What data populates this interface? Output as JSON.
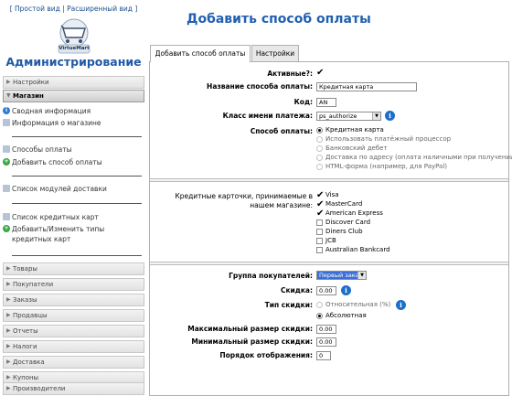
{
  "sidebar": {
    "view_simple": "Простой вид",
    "view_extended": "Расширенный вид",
    "logo_text": "VirtueMart",
    "title": "Администрирование",
    "sections": {
      "settings": "Настройки",
      "shop": "Магазин",
      "products": "Товары",
      "customers": "Покупатели",
      "orders": "Заказы",
      "vendors": "Продавцы",
      "reports": "Отчеты",
      "taxes": "Налоги",
      "shipping": "Доставка",
      "coupons": "Купоны",
      "manufacturers": "Производители"
    },
    "shop_items": {
      "summary": "Сводная информация",
      "shop_info": "Информация о магазине",
      "payment_methods": "Способы оплаты",
      "add_payment": "Добавить способ оплаты",
      "shipping_modules": "Список модулей доставки",
      "credit_cards": "Список кредитных карт",
      "add_card_types": "Добавить/Изменить типы кредитных карт"
    }
  },
  "main": {
    "title": "Добавить способ оплаты",
    "tabs": [
      "Добавить способ оплаты",
      "Настройки"
    ],
    "form": {
      "active_label": "Активные?:",
      "name_label": "Название способа оплаты:",
      "name_value": "Кредитная карта",
      "code_label": "Код:",
      "code_value": "AN",
      "class_label": "Класс имени платежа:",
      "class_value": "ps_authorize",
      "method_label": "Способ оплаты:",
      "method_options": [
        "Кредитная карта",
        "Использовать платёжный процессор",
        "Банковский дебет",
        "Доставка по адресу (оплата наличными при получении)",
        "HTML-форма (например, для PayPal)"
      ],
      "cards_label": "Кредитные карточки, принимаемые в нашем магазине:",
      "cards": [
        {
          "name": "Visa",
          "checked": true
        },
        {
          "name": "MasterCard",
          "checked": true
        },
        {
          "name": "American Express",
          "checked": true
        },
        {
          "name": "Discover Card",
          "checked": false
        },
        {
          "name": "Diners Club",
          "checked": false
        },
        {
          "name": "JCB",
          "checked": false
        },
        {
          "name": "Australian Bankcard",
          "checked": false
        }
      ],
      "group_label": "Группа покупателей:",
      "group_value": "Первый заказ",
      "discount_label": "Скидка:",
      "discount_value": "0.00",
      "discount_type_label": "Тип скидки:",
      "discount_type_relative": "Относительная (%)",
      "discount_type_absolute": "Абсолютная",
      "max_discount_label": "Максимальный размер скидки:",
      "max_discount_value": "0.00",
      "min_discount_label": "Минимальный размер скидки:",
      "min_discount_value": "0.00",
      "order_label": "Порядок отображения:",
      "order_value": "0"
    }
  },
  "colors": {
    "title_blue": "#2260b0",
    "info_blue": "#1d6fc9",
    "selection_blue": "#3b6fd6"
  }
}
